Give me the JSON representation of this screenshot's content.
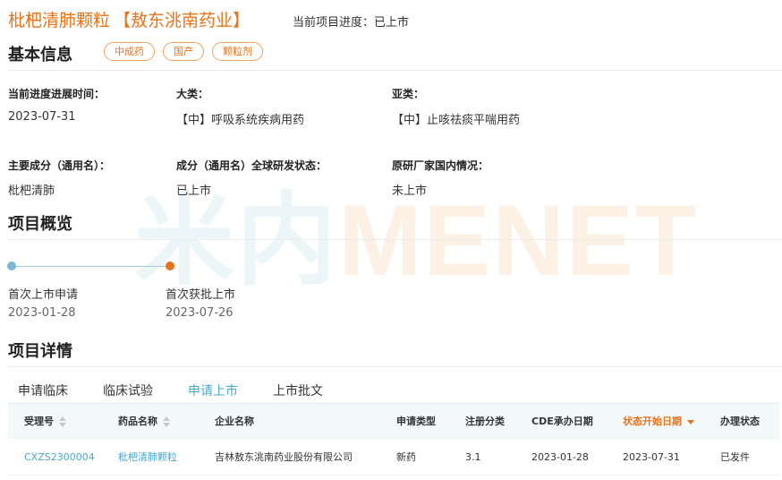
{
  "watermark": {
    "cn": "米内",
    "en": "MENET"
  },
  "header": {
    "drug_name": "枇杷清肺颗粒",
    "company": "【敖东洮南药业】",
    "progress": "当前项目进度：已上市"
  },
  "basic_info": {
    "title": "基本信息",
    "tags": [
      "中成药",
      "国产",
      "颗粒剂"
    ],
    "fields": [
      {
        "label": "当前进度进展时间：",
        "value": "2023-07-31"
      },
      {
        "label": "大类：",
        "value": "【中】呼吸系统疾病用药"
      },
      {
        "label": "亚类：",
        "value": "【中】止咳祛痰平喘用药"
      },
      {
        "label": "主要成分（通用名）：",
        "value": "枇杷清肺"
      },
      {
        "label": "成分（通用名）全球研发状态：",
        "value": "已上市"
      },
      {
        "label": "原研厂家国内情况：",
        "value": "未上市"
      }
    ]
  },
  "overview": {
    "title": "项目概览",
    "milestones": [
      {
        "label": "首次上市申请",
        "date": "2023-01-28"
      },
      {
        "label": "首次获批上市",
        "date": "2023-07-26"
      }
    ]
  },
  "details": {
    "title": "项目详情",
    "tabs": [
      "申请临床",
      "临床试验",
      "申请上市",
      "上市批文"
    ],
    "active_tab": "申请上市",
    "columns": [
      "受理号",
      "药品名称",
      "企业名称",
      "申请类型",
      "注册分类",
      "CDE承办日期",
      "状态开始日期",
      "办理状态"
    ],
    "rows": [
      [
        "CXZS2300004",
        "枇杷清肺颗粒",
        "吉林敖东洮南药业股份有限公司",
        "新药",
        "3.1",
        "2023-01-28",
        "2023-07-31",
        "已发件"
      ]
    ]
  },
  "colors": {
    "accent": "#e8731a",
    "link": "#4aa8c8"
  }
}
